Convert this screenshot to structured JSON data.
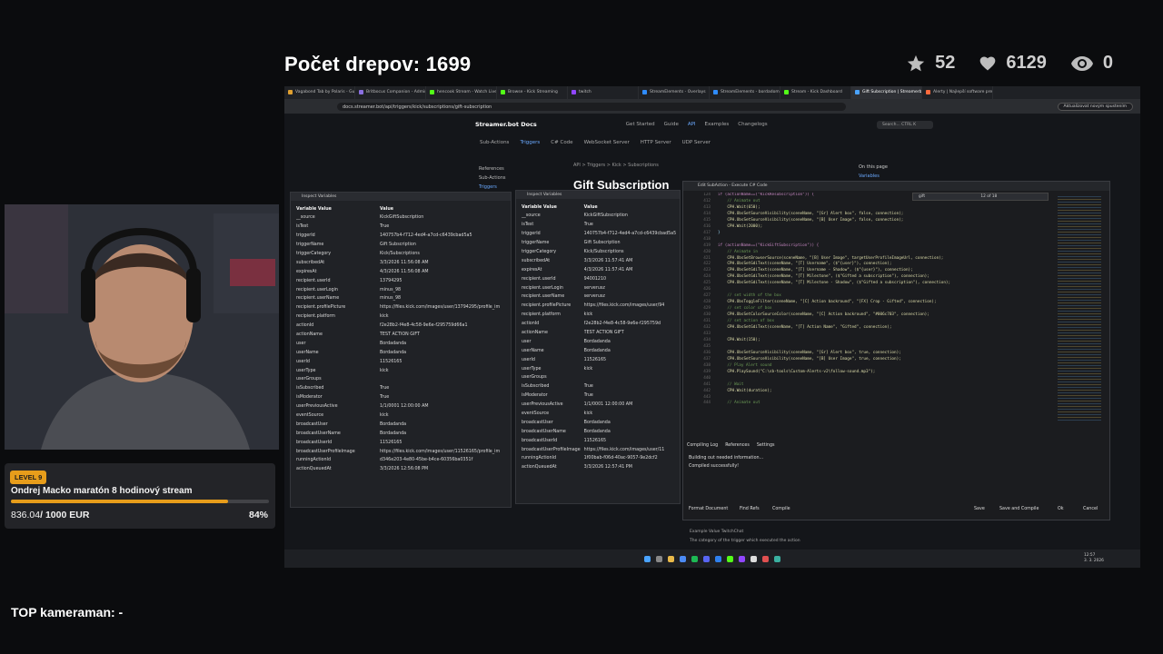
{
  "overlay": {
    "title": "Počet drepov: 1699",
    "stats": {
      "stars": "52",
      "likes": "6129",
      "viewers": "0"
    },
    "top_cameraman": "TOP kameraman: -"
  },
  "goal": {
    "level": "LEVEL 9",
    "name": "Ondrej Macko maratón 8 hodinový stream",
    "current": "836.04",
    "target": "/ 1000 EUR",
    "percent_label": "84%",
    "progress": 0.84,
    "color": "#f3a51c"
  },
  "browser": {
    "tabs": [
      {
        "label": "Vagabond Tab by Polaris - Gui",
        "color": "#e0a030"
      },
      {
        "label": "Britbocus Companion - Admin",
        "color": "#8a6fe0"
      },
      {
        "label": "hencook Stream - Watch Live",
        "color": "#53fc18"
      },
      {
        "label": "Browse - Kick Streaming",
        "color": "#53fc18"
      },
      {
        "label": "twitch",
        "color": "#9146ff"
      },
      {
        "label": "StreamElements - Overlays",
        "color": "#2f8cff"
      },
      {
        "label": "StreamElements - bordadoma",
        "color": "#2f8cff"
      },
      {
        "label": "Stream - Kick Dashboard",
        "color": "#53fc18"
      },
      {
        "label": "Gift Subscription | Streamerbo",
        "color": "#4aa3ff"
      },
      {
        "label": "Alerty | Najlepší software pre",
        "color": "#ff6a3d"
      }
    ],
    "url": "docs.streamer.bot/api/triggers/kick/subscriptions/gift-subscription",
    "update_label": "Aktualizovat novým spustením"
  },
  "docs": {
    "logo": "Streamer.bot Docs",
    "nav": [
      "Get Started",
      "Guide",
      "API",
      "Examples",
      "Changelogs"
    ],
    "search": "Search...  CTRL K",
    "subnav": [
      "Sub-Actions",
      "Triggers",
      "C# Code",
      "WebSocket Server",
      "HTTP Server",
      "UDP Server"
    ],
    "breadcrumb": "API  >  Triggers  >  Kick  >  Subscriptions",
    "heading": "Gift Subscription",
    "refs": [
      "References",
      "Sub-Actions",
      "Triggers"
    ],
    "on_page": [
      "On this page",
      "Variables"
    ],
    "example_label": "Example Value   TwitchChat",
    "description": "The category of the trigger which executed the action",
    "type_label": "string"
  },
  "inspect1": {
    "title": "Inspect Variables",
    "header": [
      "Variable Value",
      "Value"
    ],
    "rows": [
      [
        "__source",
        "KickGiftSubscription"
      ],
      [
        "isTest",
        "True"
      ],
      [
        "triggerId",
        "140757b4-f712-4ed4-a7cd-c6439cbad5a5"
      ],
      [
        "triggerName",
        "Gift Subscription"
      ],
      [
        "triggerCategory",
        "Kick/Subscriptions"
      ],
      [
        "subscribedAt",
        "3/3/2026 11:56:08 AM"
      ],
      [
        "expiresAt",
        "4/3/2026 11:56:08 AM"
      ],
      [
        "recipient.userId",
        "13794295"
      ],
      [
        "recipient.userLogin",
        "minus_98"
      ],
      [
        "recipient.userName",
        "minus_98"
      ],
      [
        "recipient.profilePicture",
        "https://files.kick.com/images/user/13794295/profile_im"
      ],
      [
        "recipient.platform",
        "kick"
      ],
      [
        "actionId",
        "f2e28b2-f4e8-4c58-9e6e-f295759d66a1"
      ],
      [
        "actionName",
        "TEST ACTION GIFT"
      ],
      [
        "user",
        "Bordadanda"
      ],
      [
        "userName",
        "Bordadanda"
      ],
      [
        "userId",
        "11526165"
      ],
      [
        "userType",
        "kick"
      ],
      [
        "userGroups",
        ""
      ],
      [
        "isSubscribed",
        "True"
      ],
      [
        "isModerator",
        "True"
      ],
      [
        "userPreviousActive",
        "1/1/0001 12:00:00 AM"
      ],
      [
        "eventSource",
        "kick"
      ],
      [
        "broadcastUser",
        "Bordadanda"
      ],
      [
        "broadcastUserName",
        "Bordadanda"
      ],
      [
        "broadcastUserId",
        "11526165"
      ],
      [
        "broadcastUserProfileImage",
        "https://files.kick.com/images/user/11526165/profile_im"
      ],
      [
        "runningActionId",
        "d346e203-4e80-45be-b4ce-60356ba0351f"
      ],
      [
        "actionQueuedAt",
        "3/3/2026 12:56:08 PM"
      ]
    ]
  },
  "inspect2": {
    "title": "Inspect Variables",
    "header": [
      "Variable Value",
      "Value"
    ],
    "rows": [
      [
        "__source",
        "KickGiftSubscription"
      ],
      [
        "isTest",
        "True"
      ],
      [
        "triggerId",
        "140757b4-f712-4ed4-a7cd-c6439cbad5a5"
      ],
      [
        "triggerName",
        "Gift Subscription"
      ],
      [
        "triggerCategory",
        "Kick/Subscriptions"
      ],
      [
        "subscribedAt",
        "3/3/2026 11:57:41 AM"
      ],
      [
        "expiresAt",
        "4/3/2026 11:57:41 AM"
      ],
      [
        "recipient.userId",
        "94001210"
      ],
      [
        "recipient.userLogin",
        "serverusz"
      ],
      [
        "recipient.userName",
        "serverusz"
      ],
      [
        "recipient.profilePicture",
        "https://files.kick.com/images/user/94"
      ],
      [
        "recipient.platform",
        "kick"
      ],
      [
        "actionId",
        "f2e28b2-f4e8-4c58-9e6e-f295759d"
      ],
      [
        "actionName",
        "TEST ACTION GIFT"
      ],
      [
        "user",
        "Bordadanda"
      ],
      [
        "userName",
        "Bordadanda"
      ],
      [
        "userId",
        "11526165"
      ],
      [
        "userType",
        "kick"
      ],
      [
        "userGroups",
        ""
      ],
      [
        "isSubscribed",
        "True"
      ],
      [
        "isModerator",
        "True"
      ],
      [
        "userPreviousActive",
        "1/1/0001 12:00:00 AM"
      ],
      [
        "eventSource",
        "kick"
      ],
      [
        "broadcastUser",
        "Bordadanda"
      ],
      [
        "broadcastUserName",
        "Bordadanda"
      ],
      [
        "broadcastUserId",
        "11526165"
      ],
      [
        "broadcastUserProfileImage",
        "https://files.kick.com/images/user/11"
      ],
      [
        "runningActionId",
        "1f00bab-f06d-40ac-9057-9e2dcf2"
      ],
      [
        "actionQueuedAt",
        "3/3/2026 12:57:41 PM"
      ]
    ]
  },
  "editor": {
    "title": "Edit SubAction - Execute C# Code",
    "find": "gift",
    "find_count": "12 of 18",
    "lines": [
      [
        "124",
        "if (actionName==(\"KickResubscription\")) {",
        "kw"
      ],
      [
        "412",
        "    // Animate out",
        "cm"
      ],
      [
        "413",
        "    CPH.Wait(650);",
        "fn"
      ],
      [
        "414",
        "    CPH.ObsSetSourceVisibility(sceneName, \"[Gr] Alert box\", false, connection);",
        "fn"
      ],
      [
        "415",
        "    CPH.ObsSetSourceVisibility(sceneName, \"[B] User Image\", false, connection);",
        "fn"
      ],
      [
        "416",
        "    CPH.Wait(2000);",
        "fn"
      ],
      [
        "417",
        "}",
        "tx"
      ],
      [
        "418",
        "",
        "tx"
      ],
      [
        "419",
        "if (actionName==(\"KickGiftSubscription\")) {",
        "kw"
      ],
      [
        "420",
        "    // Animate in",
        "cm"
      ],
      [
        "421",
        "    CPH.ObsSetBrowserSource(sceneName, \"[B] User Image\", targetUserProfileImageUrl, connection);",
        "fn"
      ],
      [
        "422",
        "    CPH.ObsSetGdiText(sceneName, \"[T] Username\", ($\"{user}\"), connection);",
        "fn"
      ],
      [
        "423",
        "    CPH.ObsSetGdiText(sceneName, \"[T] Username - Shadow\", ($\"{user}\"), connection);",
        "fn"
      ],
      [
        "424",
        "    CPH.ObsSetGdiText(sceneName, \"[T] Milestone\", ($\"Gifted a subscription\"), connection);",
        "fn"
      ],
      [
        "425",
        "    CPH.ObsSetGdiText(sceneName, \"[T] Milestone - Shadow\", ($\"Gifted a subscription\"), connection);",
        "fn"
      ],
      [
        "426",
        "",
        "tx"
      ],
      [
        "427",
        "    // set width of the box",
        "cm"
      ],
      [
        "428",
        "    CPH.ObsToggleFilter(sceneName, \"[C] Action backround\", \"[FX] Crop - Gifted\", connection);",
        "fn"
      ],
      [
        "429",
        "    // set color of box",
        "cm"
      ],
      [
        "430",
        "    CPH.ObsSetColorSourceColor(sceneName, \"[C] Action backround\", \"#006c703\", connection);",
        "fn"
      ],
      [
        "431",
        "    // set action of box",
        "cm"
      ],
      [
        "432",
        "    CPH.ObsSetGdiText(sceneName, \"[T] Action Name\", \"Gifted\", connection);",
        "fn"
      ],
      [
        "433",
        "",
        "tx"
      ],
      [
        "434",
        "    CPH.Wait(150);",
        "fn"
      ],
      [
        "435",
        "",
        "tx"
      ],
      [
        "436",
        "    CPH.ObsSetSourceVisibility(sceneName, \"[Gr] Alert box\", true, connection);",
        "fn"
      ],
      [
        "437",
        "    CPH.ObsSetSourceVisibility(sceneName, \"[B] User Image\", true, connection);",
        "fn"
      ],
      [
        "438",
        "    // Play Alert sound",
        "cm"
      ],
      [
        "439",
        "    CPH.PlaySound(\"C:\\sb-tools\\Custom-Alerts-v2\\follow-sound.mp3\");",
        "fn"
      ],
      [
        "440",
        "",
        "tx"
      ],
      [
        "441",
        "    // Wait",
        "cm"
      ],
      [
        "442",
        "    CPH.Wait(duration);",
        "fn"
      ],
      [
        "443",
        "",
        "tx"
      ],
      [
        "444",
        "    // Animate out",
        "cm"
      ]
    ],
    "output_tabs": [
      "Compiling Log",
      "References",
      "Settings"
    ],
    "output_lines": [
      "Building out needed information...",
      "Compiled successfully!"
    ],
    "buttons": [
      "Format Document",
      "Find Refs",
      "Compile",
      "Save",
      "Save and Compile",
      "Ok",
      "Cancel"
    ]
  },
  "tray": {
    "lang": "SVK\nUS",
    "time": "12:57",
    "date": "3. 3. 2026"
  }
}
